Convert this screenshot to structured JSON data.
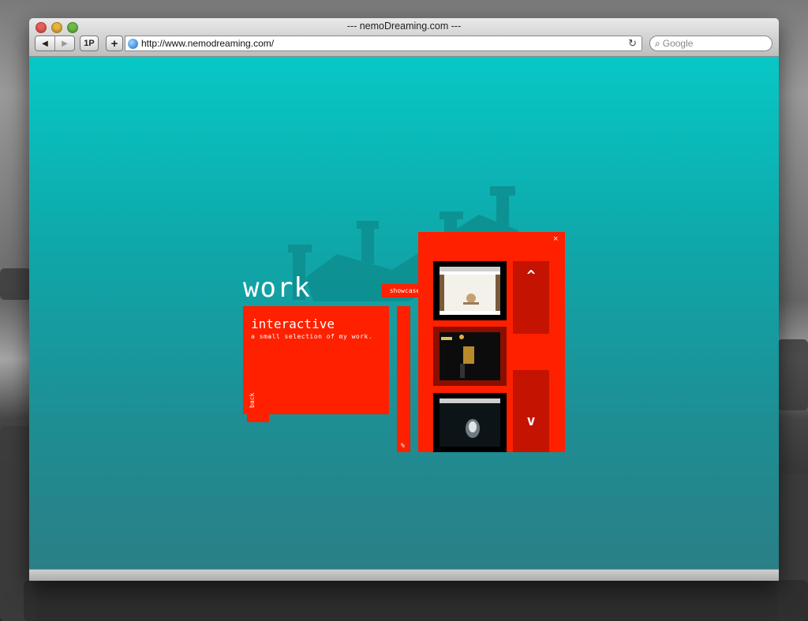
{
  "window": {
    "title": "--- nemoDreaming.com ---",
    "url": "http://www.nemodreaming.com/",
    "search_placeholder": "Google",
    "btn_back": "◀",
    "btn_forward": "▶",
    "btn_1p": "1P",
    "btn_add": "+",
    "reload_glyph": "↻"
  },
  "page": {
    "heading": "work",
    "panel_title": "interactive",
    "panel_subtitle": "a small selection of my work.",
    "back_label": "back",
    "showcase_tab": "showcase",
    "strip_glyph": "%",
    "close_glyph": "×",
    "scroll_up_glyph": "^",
    "scroll_down_glyph": "v"
  },
  "colors": {
    "panel_red": "#ff2000",
    "scroll_red": "#c41300",
    "background_teal": "#0ea9ab"
  }
}
